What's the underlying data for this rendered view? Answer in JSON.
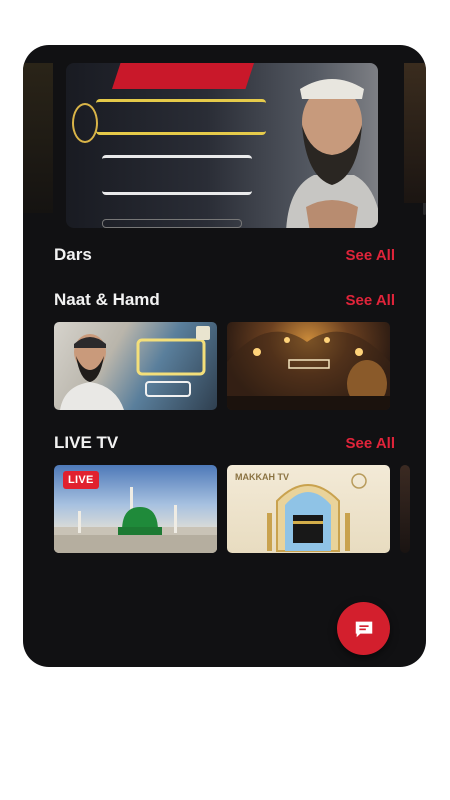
{
  "sections": [
    {
      "title": "Dars",
      "see_all": "See All"
    },
    {
      "title": "Naat & Hamd",
      "see_all": "See All"
    },
    {
      "title": "LIVE TV",
      "see_all": "See All"
    }
  ],
  "live_tv": {
    "badge": "LIVE",
    "channel_label": "MAKKAH TV"
  },
  "colors": {
    "accent": "#e0243a",
    "background": "#111113",
    "fab": "#d31f2d"
  },
  "icons": {
    "fab": "chat-bubble-icon"
  }
}
